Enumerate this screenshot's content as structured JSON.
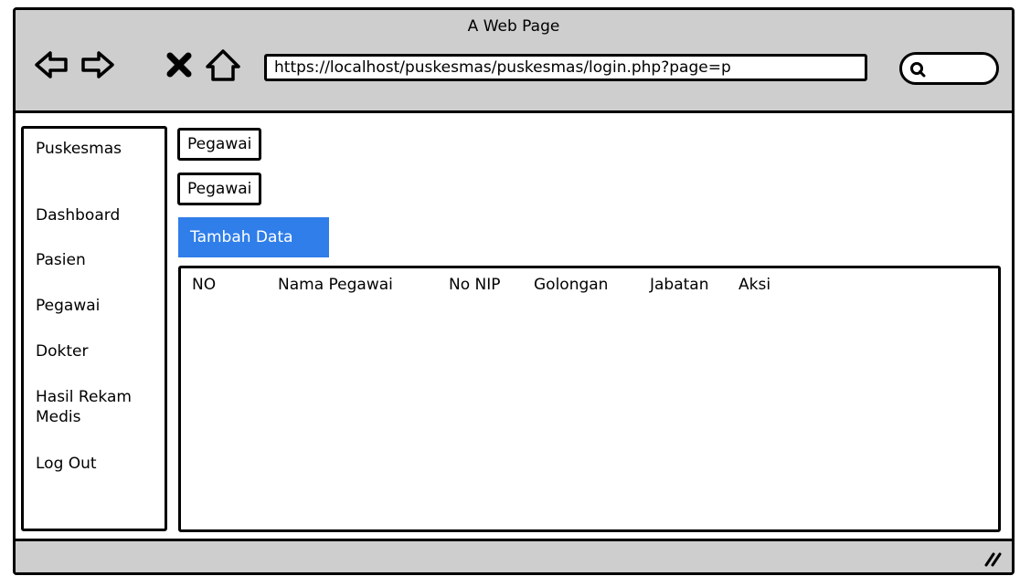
{
  "window": {
    "title": "A Web Page"
  },
  "browser": {
    "url": "https://localhost/puskesmas/puskesmas/login.php?page=p"
  },
  "sidebar": {
    "items": [
      {
        "label": "Puskesmas"
      },
      {
        "label": "Dashboard"
      },
      {
        "label": "Pasien"
      },
      {
        "label": "Pegawai"
      },
      {
        "label": "Dokter"
      },
      {
        "label": "Hasil Rekam\nMedis"
      },
      {
        "label": "Log Out"
      }
    ]
  },
  "main": {
    "breadcrumb_1": "Pegawai",
    "breadcrumb_2": "Pegawai",
    "add_button": "Tambah Data",
    "table": {
      "headers": [
        "NO",
        "Nama Pegawai",
        "No NIP",
        "Golongan",
        "Jabatan",
        "Aksi"
      ]
    }
  },
  "colors": {
    "accent": "#2f7ee9",
    "chrome": "#cecece"
  },
  "icons": [
    "back-arrow-icon",
    "forward-arrow-icon",
    "close-icon",
    "home-icon",
    "search-icon",
    "resize-grip-icon"
  ]
}
